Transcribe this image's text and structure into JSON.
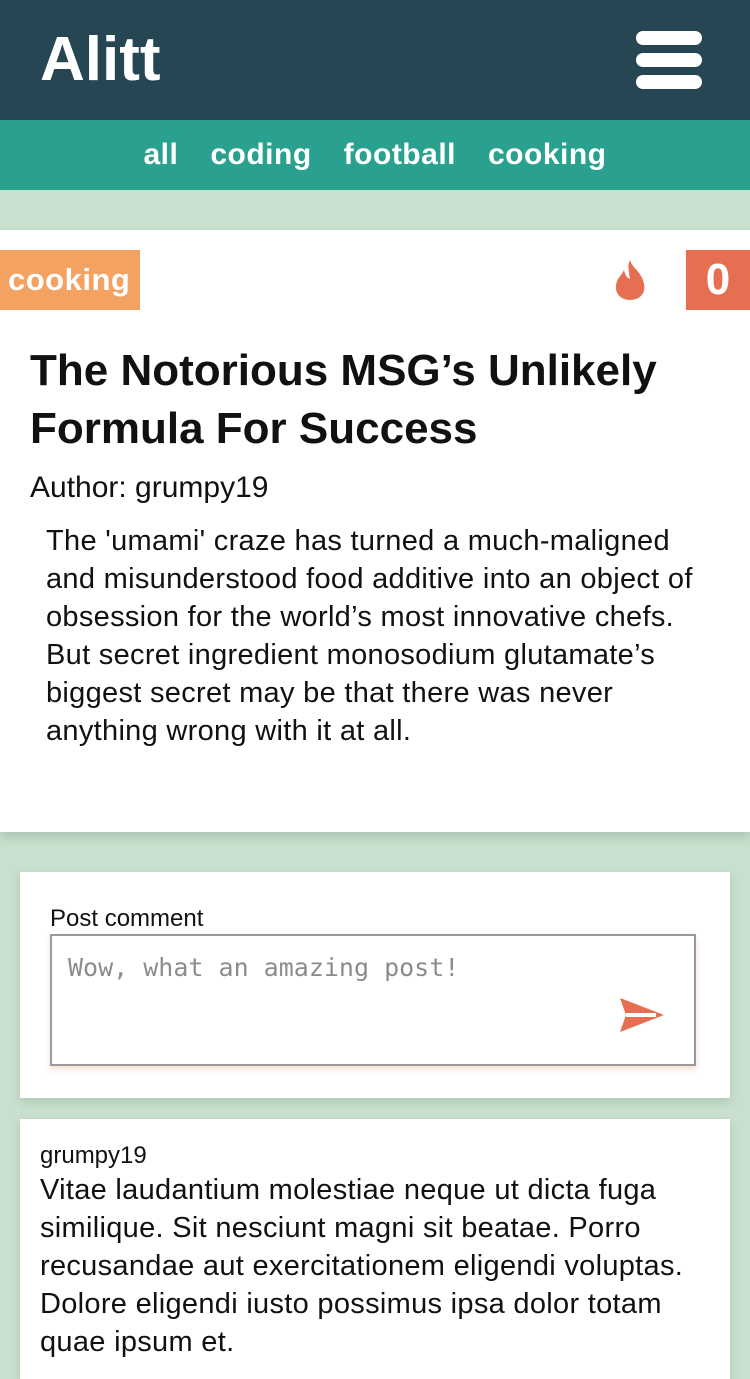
{
  "header": {
    "logo": "Alitt",
    "menu_icon": "hamburger-menu-icon"
  },
  "nav": {
    "items": [
      {
        "label": "all"
      },
      {
        "label": "coding"
      },
      {
        "label": "football"
      },
      {
        "label": "cooking"
      }
    ]
  },
  "post": {
    "category": "cooking",
    "vote_icon": "flame-icon",
    "score": "0",
    "title": "The Notorious MSG’s Unlikely Formula For Success",
    "author_line": "Author: grumpy19",
    "body": "The 'umami' craze has turned a much-maligned and misunderstood food additive into an object of obsession for the world’s most innovative chefs. But secret ingredient monosodium glutamate’s biggest secret may be that there was never anything wrong with it at all."
  },
  "comment_form": {
    "label": "Post comment",
    "placeholder": "Wow, what an amazing post!",
    "value": "",
    "send_icon": "send-arrow-icon"
  },
  "comments": [
    {
      "author": "grumpy19",
      "text": "Vitae laudantium molestiae neque ut dicta fuga similique. Sit nesciunt magni sit beatae. Porro recusandae aut exercitationem eligendi voluptas. Dolore eligendi iusto possimus ipsa dolor totam quae ipsum et."
    }
  ],
  "colors": {
    "header_bg": "#274654",
    "nav_bg": "#2aa08e",
    "page_bg": "#c8e0cd",
    "category_badge": "#f4a261",
    "accent": "#e76f51"
  }
}
